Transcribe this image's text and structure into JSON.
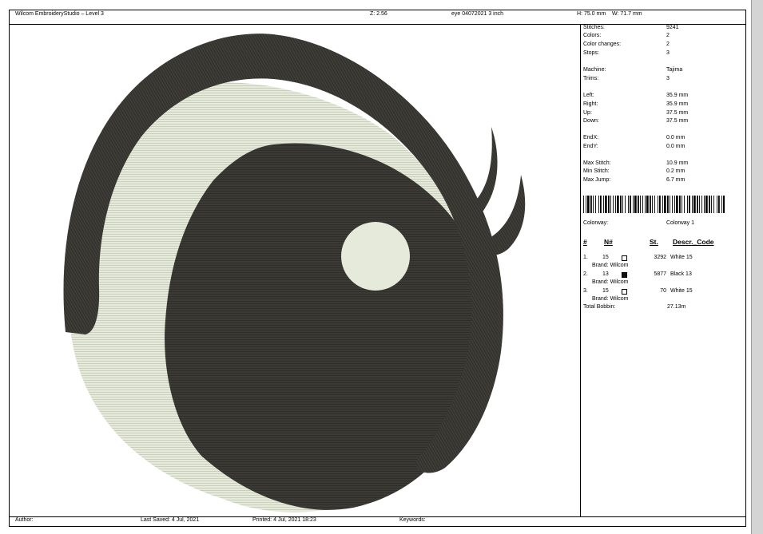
{
  "header": {
    "app_title": "Wilcom EmbroideryStudio – Level 3",
    "zoom": "Z: 2.56",
    "design_name": "eye 04072021 3 inch",
    "height": "H: 75.0 mm",
    "width": "W: 71.7 mm"
  },
  "stats": [
    {
      "label": "Stitches:",
      "value": "9241"
    },
    {
      "label": "Colors:",
      "value": "2"
    },
    {
      "label": "Color changes:",
      "value": "2"
    },
    {
      "label": "Stops:",
      "value": "3"
    },
    {
      "label": "Machine:",
      "value": "Tajima"
    },
    {
      "label": "Trims:",
      "value": "3"
    },
    {
      "label": "Left:",
      "value": "35.9 mm"
    },
    {
      "label": "Right:",
      "value": "35.9 mm"
    },
    {
      "label": "Up:",
      "value": "37.5 mm"
    },
    {
      "label": "Down:",
      "value": "37.5 mm"
    },
    {
      "label": "EndX:",
      "value": "0.0 mm"
    },
    {
      "label": "EndY:",
      "value": "0.0 mm"
    },
    {
      "label": "Max Stitch:",
      "value": "10.9 mm"
    },
    {
      "label": "Min Stitch:",
      "value": "0.2 mm"
    },
    {
      "label": "Max Jump:",
      "value": "6.7 mm"
    }
  ],
  "colorway": {
    "label": "Colorway:",
    "value": "Colorway 1"
  },
  "color_table": {
    "headers": {
      "index": "#",
      "number": "N#",
      "stitches": "St.",
      "description": "Descr._Code"
    },
    "rows": [
      {
        "index": "1.",
        "number": "15",
        "swatch": "#ffffff",
        "stitches": "3292",
        "description": "White 15",
        "brand": "Brand: Wilcom"
      },
      {
        "index": "2.",
        "number": "13",
        "swatch": "#111111",
        "stitches": "5877",
        "description": "Black 13",
        "brand": "Brand: Wilcom"
      },
      {
        "index": "3.",
        "number": "15",
        "swatch": "#ffffff",
        "stitches": "70",
        "description": "White 15",
        "brand": "Brand: Wilcom"
      }
    ],
    "total_bobbin_label": "Total Bobbin:",
    "total_bobbin_value": "27.13m"
  },
  "footer": {
    "author": "Author:",
    "last_saved": "Last Saved:  4 Jul, 2021",
    "printed": "Printed:  4 Jul, 2021 18:23",
    "keywords": "Keywords:"
  },
  "colors": {
    "thread_black": "#3b3a35",
    "thread_white": "#e6eadb",
    "page_background": "#ffffff",
    "window_background": "#c8c8c8"
  },
  "design_motifs": [
    "eyelid-shape",
    "eye-white-shape",
    "pupil-shape",
    "highlight-shape",
    "eyelash-shape"
  ]
}
